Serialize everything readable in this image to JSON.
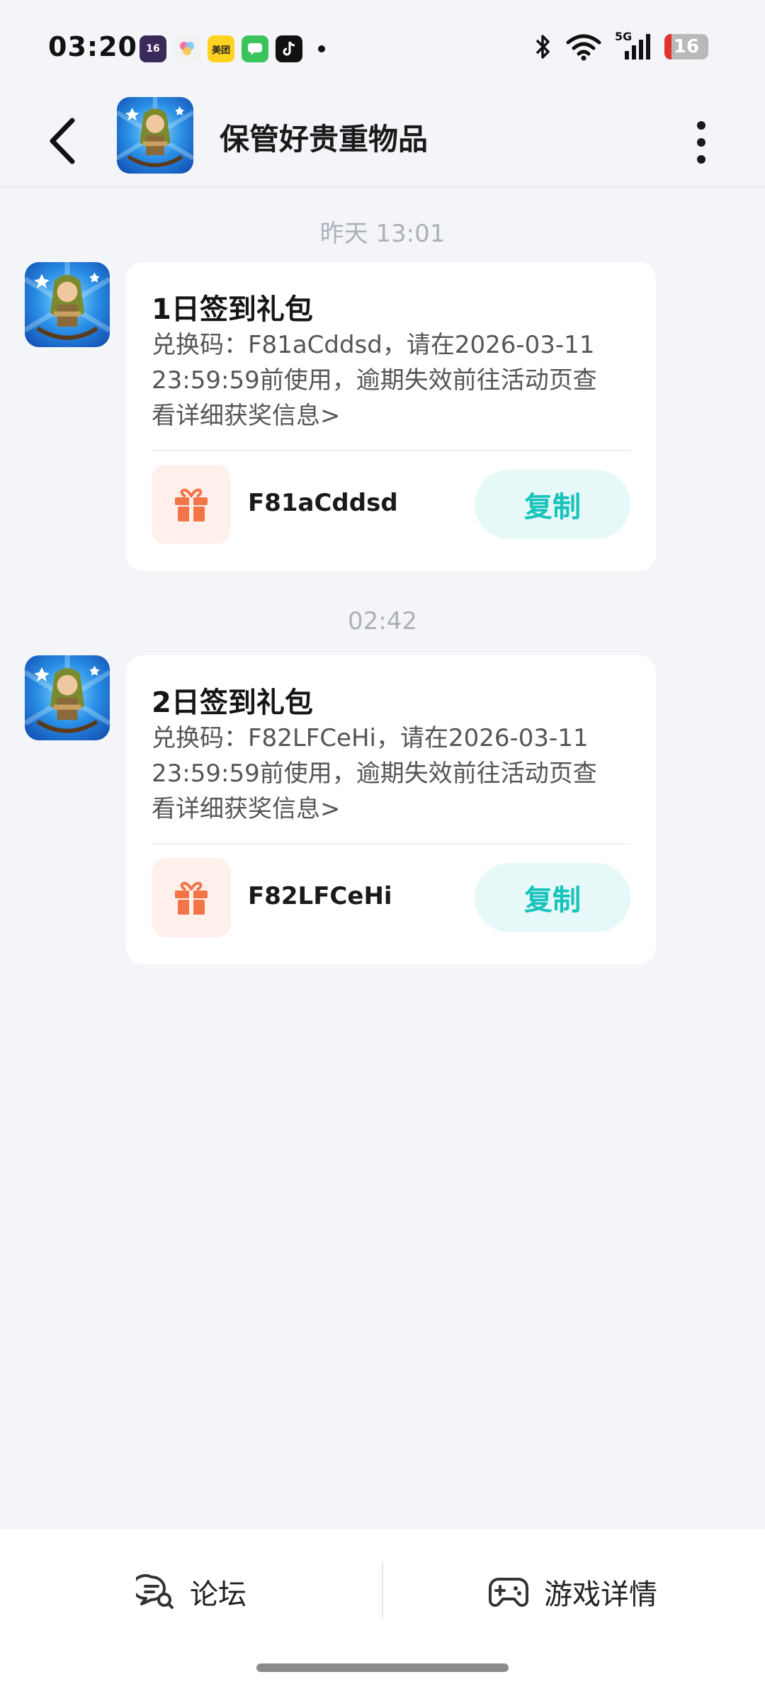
{
  "status_bar": {
    "time": "03:20",
    "app_icons": [
      "16",
      "",
      "美团",
      "",
      ""
    ],
    "network": "5G",
    "battery": "16"
  },
  "header": {
    "title": "保管好贵重物品"
  },
  "messages": [
    {
      "timestamp": "昨天  13:01",
      "title": "1日签到礼包",
      "description": "兑换码：F81aCddsd，请在2026-03-11 23:59:59前使用，逾期失效前往活动页查看详细获奖信息>",
      "code": "F81aCddsd",
      "copy_label": "复制"
    },
    {
      "timestamp": "02:42",
      "title": "2日签到礼包",
      "description": "兑换码：F82LFCeHi，请在2026-03-11 23:59:59前使用，逾期失效前往活动页查看详细获奖信息>",
      "code": "F82LFCeHi",
      "copy_label": "复制"
    }
  ],
  "bottom_bar": {
    "forum_label": "论坛",
    "game_details_label": "游戏详情"
  },
  "colors": {
    "accent": "#17c3bd",
    "copy_bg": "#e6f8f8",
    "gift": "#f27447",
    "gift_bg": "#fff0ec",
    "page_bg": "#f4f5f9"
  },
  "icons": {
    "back": "back-arrow-icon",
    "more": "more-vertical-icon",
    "gift": "gift-icon",
    "forum": "forum-icon",
    "gamepad": "gamepad-icon"
  }
}
